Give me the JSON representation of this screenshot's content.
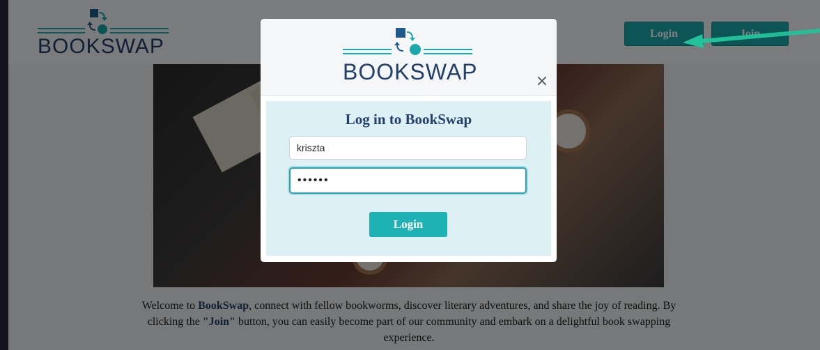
{
  "brand": {
    "name": "BOOKSWAP"
  },
  "header": {
    "login_label": "Login",
    "join_label": "Join"
  },
  "welcome": {
    "prefix": "Welcome to ",
    "brand": "BookSwap",
    "middle": ", connect with fellow bookworms, discover literary adventures, and share the joy of reading. By clicking the ",
    "join_quote": "\"Join\"",
    "suffix": " button, you can easily become part of our community and embark on a delightful book swapping experience."
  },
  "modal": {
    "title": "Log in to BookSwap",
    "close_glyph": "×",
    "username_value": "kriszta",
    "password_value": "123456",
    "submit_label": "Login"
  },
  "colors": {
    "teal": "#1aa8ad",
    "navy": "#23406a",
    "modal_body": "#ddf1f4",
    "arrow": "#22c39a"
  }
}
